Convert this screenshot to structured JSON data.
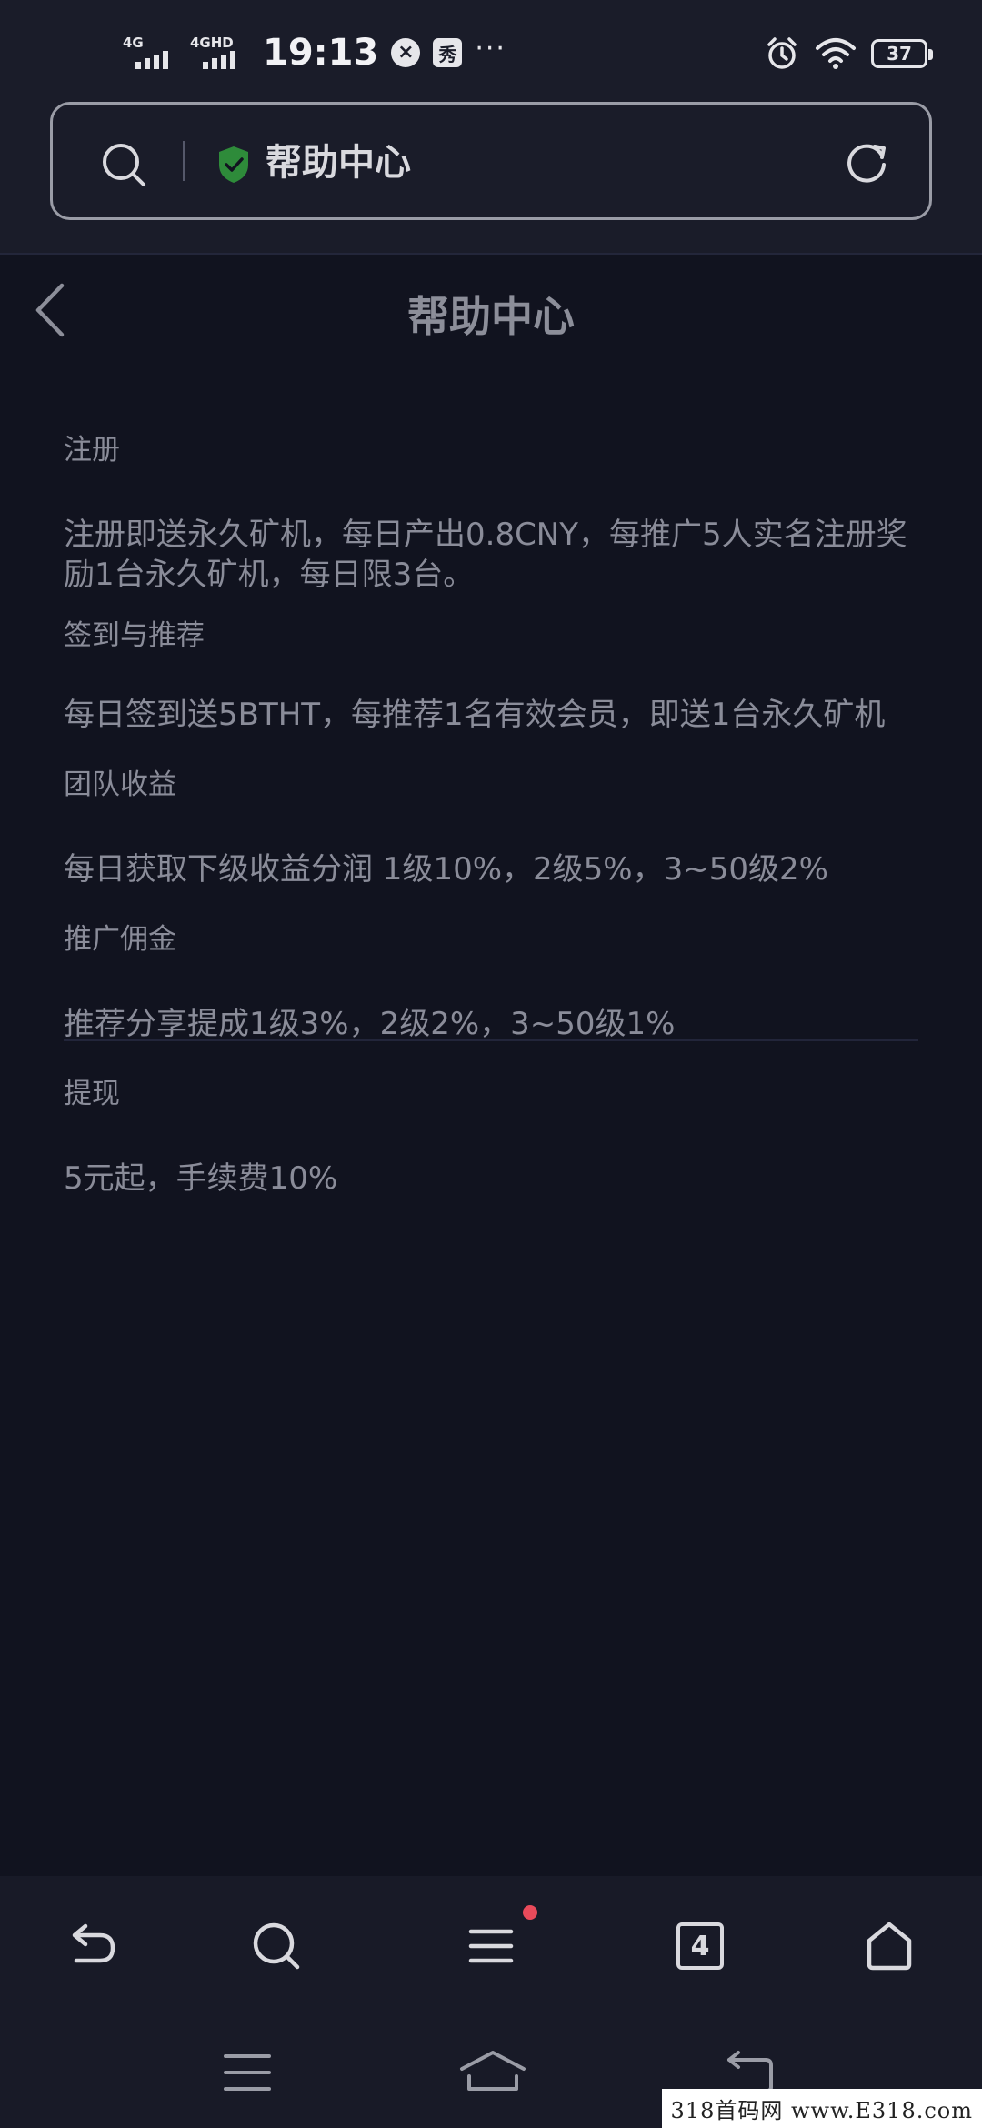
{
  "status_bar": {
    "time": "19:13",
    "signal1_label": "4G",
    "signal2_label": "4GHD",
    "notif_close_icon": "x-circle-icon",
    "notif_app_label": "秀",
    "more_dots": "···",
    "battery_level": "37"
  },
  "address_bar": {
    "title": "帮助中心",
    "search_icon": "search-icon",
    "secure_icon": "shield-check-icon",
    "reload_icon": "reload-icon",
    "shield_color": "#2e8b3a"
  },
  "page": {
    "title": "帮助中心",
    "back_icon": "chevron-left-icon"
  },
  "sections": [
    {
      "heading": "注册",
      "body": "注册即送永久矿机，每日产出0.8CNY，每推广5人实名注册奖励1台永久矿机，每日限3台。"
    },
    {
      "heading": "签到与推荐",
      "body": "每日签到送5BTHT，每推荐1名有效会员，即送1台永久矿机"
    },
    {
      "heading": "团队收益",
      "body": "每日获取下级收益分润 1级10%，2级5%，3~50级2%"
    },
    {
      "heading": "推广佣金",
      "body": "推荐分享提成1级3%，2级2%，3~50级1%"
    },
    {
      "heading": "提现",
      "body": "5元起，手续费10%"
    }
  ],
  "bottom_nav": {
    "back_icon": "back-arrow-icon",
    "search_icon": "search-icon",
    "menu_icon": "menu-icon",
    "tabs_count": "4",
    "home_icon": "home-icon",
    "badge_color": "#e84a5a"
  },
  "system_nav": {
    "menu_icon": "menu-icon",
    "home_icon": "home-icon",
    "back_icon": "back-icon"
  },
  "watermark": "318首码网 www.E318.com"
}
